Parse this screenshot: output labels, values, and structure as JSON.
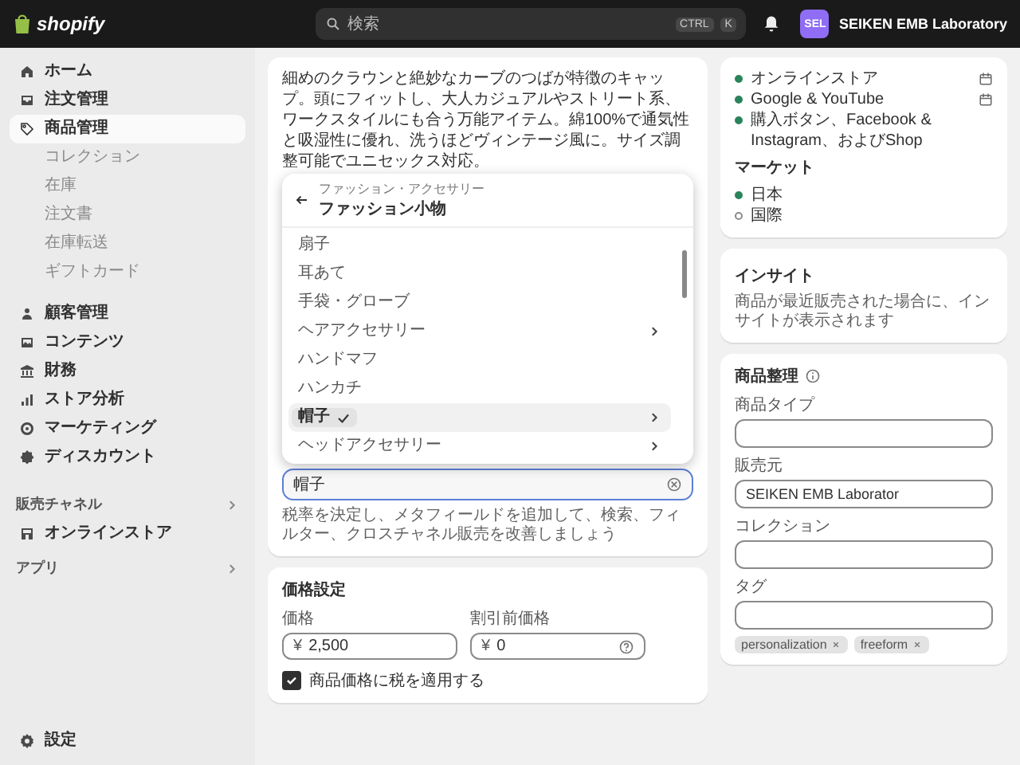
{
  "topbar": {
    "logo": "shopify",
    "search_placeholder": "検索",
    "shortcut_keys": [
      "CTRL",
      "K"
    ],
    "avatar": "SEL",
    "store_name": "SEIKEN EMB Laboratory"
  },
  "sidebar": {
    "groups": [
      {
        "items": [
          {
            "label": "ホーム",
            "selected": false
          },
          {
            "label": "注文管理",
            "selected": false
          },
          {
            "label": "商品管理",
            "selected": true,
            "children": [
              {
                "label": "コレクション",
                "selected": false
              },
              {
                "label": "在庫",
                "selected": false
              },
              {
                "label": "注文書",
                "selected": false
              },
              {
                "label": "在庫転送",
                "selected": false
              },
              {
                "label": "ギフトカード",
                "selected": false
              }
            ]
          }
        ]
      },
      {
        "items": [
          {
            "label": "顧客管理",
            "selected": false
          },
          {
            "label": "コンテンツ",
            "selected": false
          },
          {
            "label": "財務",
            "selected": false
          },
          {
            "label": "ストア分析",
            "selected": false
          },
          {
            "label": "マーケティング",
            "selected": false
          },
          {
            "label": "ディスカウント",
            "selected": false
          }
        ]
      }
    ],
    "sales_channels": {
      "title": "販売チャネル",
      "items": [
        {
          "label": "オンラインストア",
          "selected": false
        }
      ]
    },
    "apps": {
      "title": "アプリ"
    },
    "settings": "設定"
  },
  "description": {
    "text": "細めのクラウンと絶妙なカーブのつばが特徴のキャップ。頭にフィットし、大人カジュアルやストリート系、ワークスタイルにも合う万能アイテム。綿100%で通気性と吸湿性に優れ、洗うほどヴィンテージ風に。サイズ調整可能でユニセックス対応。"
  },
  "category": {
    "breadcrumb": "ファッション・アクセサリー",
    "title": "ファッション小物",
    "options": [
      {
        "label": "扇子",
        "selected": false,
        "has_children": false
      },
      {
        "label": "耳あて",
        "selected": false,
        "has_children": false
      },
      {
        "label": "手袋・グローブ",
        "selected": false,
        "has_children": false
      },
      {
        "label": "ヘアアクセサリー",
        "selected": false,
        "has_children": true
      },
      {
        "label": "ハンドマフ",
        "selected": false,
        "has_children": false
      },
      {
        "label": "ハンカチ",
        "selected": false,
        "has_children": false
      },
      {
        "label": "帽子",
        "selected": true,
        "has_children": true
      },
      {
        "label": "ヘッドアクセサリー",
        "selected": false,
        "has_children": true
      }
    ],
    "value": "帽子",
    "help": "税率を決定し、メタフィールドを追加して、検索、フィルター、クロスチャネル販売を改善しましょう"
  },
  "pricing": {
    "title": "価格設定",
    "fields": [
      {
        "label": "価格",
        "currency": "¥",
        "value": "2,500",
        "help_icon": false
      },
      {
        "label": "割引前価格",
        "currency": "¥",
        "value": "0",
        "help_icon": true
      }
    ],
    "tax": {
      "label": "商品価格に税を適用する",
      "checked": true
    }
  },
  "channels": {
    "items": [
      {
        "label": "オンラインストア",
        "active": true,
        "status_icon": true
      },
      {
        "label": "Google & YouTube",
        "active": true,
        "status_icon": true
      },
      {
        "label": "購入ボタン、Facebook & Instagram、およびShop",
        "active": true,
        "status_icon": false
      }
    ]
  },
  "markets": {
    "title": "マーケット",
    "items": [
      {
        "label": "日本",
        "active": true
      },
      {
        "label": "国際",
        "active": false
      }
    ]
  },
  "insights": {
    "title": "インサイト",
    "text": "商品が最近販売された場合に、インサイトが表示されます"
  },
  "organization": {
    "title": "商品整理",
    "fields": [
      {
        "label": "商品タイプ"
      },
      {
        "label": "販売元",
        "value": "SEIKEN EMB Laborator"
      },
      {
        "label": "コレクション"
      },
      {
        "label": "タグ",
        "tags": [
          "personalization",
          "freeform"
        ]
      }
    ]
  }
}
